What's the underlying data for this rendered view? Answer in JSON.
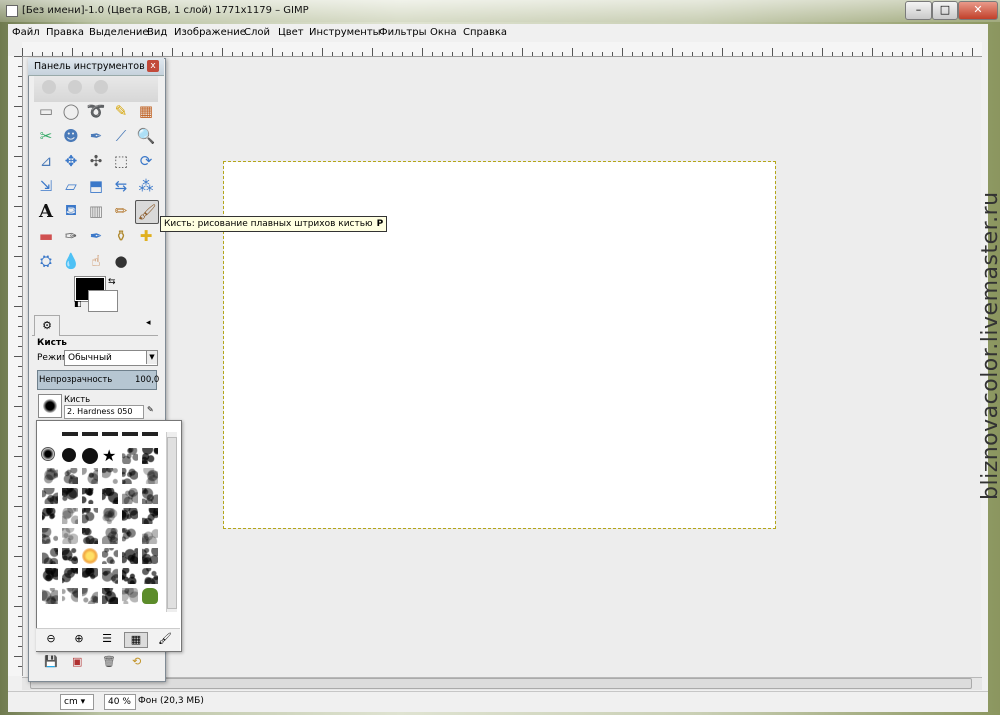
{
  "window": {
    "title": "[Без имени]-1.0 (Цвета RGB, 1 слой) 1771x1179 – GIMP",
    "minimize": "–",
    "maximize": "□",
    "close": "✕"
  },
  "menu": [
    "Файл",
    "Правка",
    "Выделение",
    "Вид",
    "Изображение",
    "Слой",
    "Цвет",
    "Инструменты",
    "Фильтры",
    "Окна",
    "Справка"
  ],
  "toolbox": {
    "title": "Панель инструментов —",
    "close": "x",
    "tools": [
      "rect-select-icon",
      "ellipse-select-icon",
      "lasso-icon",
      "fuzzy-select-icon",
      "color-select-icon",
      "scissors-icon",
      "foreground-select-icon",
      "paths-icon",
      "color-picker-icon",
      "zoom-icon",
      "measure-icon",
      "move-icon",
      "align-icon",
      "crop-icon",
      "rotate-icon",
      "scale-icon",
      "shear-icon",
      "perspective-icon",
      "flip-icon",
      "cage-icon",
      "text-icon",
      "bucket-fill-icon",
      "blend-icon",
      "pencil-icon",
      "paintbrush-icon",
      "eraser-icon",
      "airbrush-icon",
      "ink-icon",
      "clone-icon",
      "heal-icon",
      "perspective-clone-icon",
      "blur-icon",
      "smudge-icon",
      "dodge-burn-icon"
    ],
    "tool_glyphs": [
      "▭",
      "◯",
      "➰",
      "✎",
      "▦",
      "✂",
      "☻",
      "✒",
      "⟋",
      "🔍",
      "⊿",
      "✥",
      "✣",
      "⬚",
      "⟳",
      "⇲",
      "▱",
      "⬒",
      "⇆",
      "⁂",
      "A",
      "⛾",
      "▥",
      "✏",
      "🖌",
      "▬",
      "✑",
      "✒",
      "⚱",
      "✚",
      "⛭",
      "💧",
      "☝",
      "●"
    ],
    "tool_colors": [
      "#777",
      "#777",
      "#777",
      "#d6a400",
      "#c06020",
      "#3a6",
      "#4a7ab8",
      "#4a7ab8",
      "#4a7ab8",
      "#4a7ab8",
      "#4a7ab8",
      "#3b78c9",
      "#555",
      "#555",
      "#3b78c9",
      "#3b78c9",
      "#3b78c9",
      "#3b78c9",
      "#3b78c9",
      "#3b78c9",
      "#111",
      "#3b78c9",
      "#888",
      "#b57a30",
      "#8a5a2a",
      "#d05050",
      "#555",
      "#3b78c9",
      "#b08a30",
      "#e0b020",
      "#3b78c9",
      "#3b78c9",
      "#c07030",
      "#333"
    ],
    "tool_options_tab": "⚙",
    "options_title": "Кисть",
    "mode_label": "Режим:",
    "mode_value": "Обычный",
    "opacity_label": "Непрозрачность",
    "opacity_value": "100,0",
    "brush_label": "Кисть",
    "brush_name": "2. Hardness 050"
  },
  "tooltip": {
    "text": "Кисть: рисование плавных штрихов кистью",
    "key": "P"
  },
  "status": {
    "unit": "cm",
    "zoom": "40 %",
    "info": "Фон (20,3 МБ)"
  },
  "watermark": "bliznovacolor.livemaster.ru"
}
